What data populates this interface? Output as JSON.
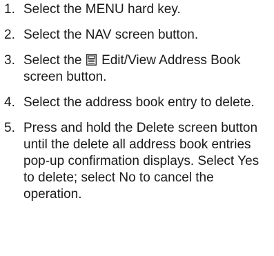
{
  "steps": [
    {
      "number": "1.",
      "text": "Select the MENU hard key."
    },
    {
      "number": "2.",
      "text": "Select the NAV screen button."
    },
    {
      "number": "3.",
      "text_before": "Select the",
      "icon": "address-book-icon",
      "text_after": "Edit/View Address Book screen button."
    },
    {
      "number": "4.",
      "text": "Select the address book entry to delete."
    },
    {
      "number": "5.",
      "text": "Press and hold the Delete screen button until the delete all address book entries pop-up confirmation displays. Select Yes to delete; select No to cancel the operation."
    }
  ]
}
